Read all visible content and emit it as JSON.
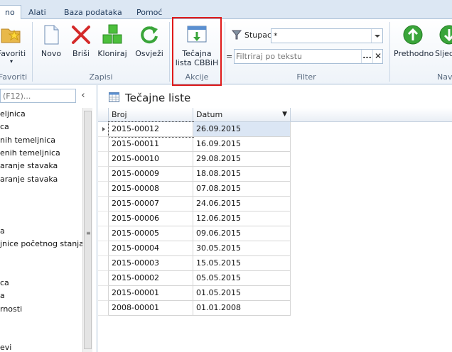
{
  "tabs": [
    {
      "label": "no",
      "active": true
    },
    {
      "label": "Alati",
      "active": false
    },
    {
      "label": "Baza podataka",
      "active": false
    },
    {
      "label": "Pomoć",
      "active": false
    }
  ],
  "ribbon": {
    "favoriti": {
      "label": "Favoriti",
      "group": "Favoriti"
    },
    "zapisi": {
      "group": "Zapisi",
      "buttons": [
        "Novo",
        "Briši",
        "Kloniraj",
        "Osvježi"
      ]
    },
    "akcije": {
      "group": "Akcije",
      "tecajna_line1": "Tečajna",
      "tecajna_line2": "lista CBBiH"
    },
    "filter": {
      "group": "Filter",
      "stupac_label": "Stupac",
      "stupac_value": "*",
      "eq": "=",
      "search_placeholder": "Filtriraj po tekstu",
      "dots": "...",
      "clear": "✕"
    },
    "nav": {
      "prethodno": "Prethodno",
      "sljedece": "Sljed",
      "group": "Nav"
    }
  },
  "nav": {
    "search_placeholder": "(F12)...",
    "collapse": "‹",
    "items": [
      "eljnica",
      "ca",
      "nih temeljnica",
      "enih temeljnica",
      "aranje stavaka",
      "aranje stavaka",
      "",
      "",
      "",
      "a",
      "jnice početnog stanja",
      "",
      "",
      "ca",
      "a",
      "rnosti",
      "",
      "",
      "evi"
    ]
  },
  "main": {
    "title": "Tečajne liste",
    "columns": [
      "Broj",
      "Datum"
    ],
    "rows": [
      [
        "2015-00012",
        "26.09.2015"
      ],
      [
        "2015-00011",
        "16.09.2015"
      ],
      [
        "2015-00010",
        "29.08.2015"
      ],
      [
        "2015-00009",
        "18.08.2015"
      ],
      [
        "2015-00008",
        "07.08.2015"
      ],
      [
        "2015-00007",
        "24.06.2015"
      ],
      [
        "2015-00006",
        "12.06.2015"
      ],
      [
        "2015-00005",
        "09.06.2015"
      ],
      [
        "2015-00004",
        "30.05.2015"
      ],
      [
        "2015-00003",
        "15.05.2015"
      ],
      [
        "2015-00002",
        "05.05.2015"
      ],
      [
        "2015-00001",
        "01.05.2015"
      ],
      [
        "2008-00001",
        "01.01.2008"
      ]
    ]
  },
  "colors": {
    "highlight": "#e01a1a",
    "accent": "#1e395b",
    "green": "#3aa53a",
    "red": "#d42a2a"
  }
}
